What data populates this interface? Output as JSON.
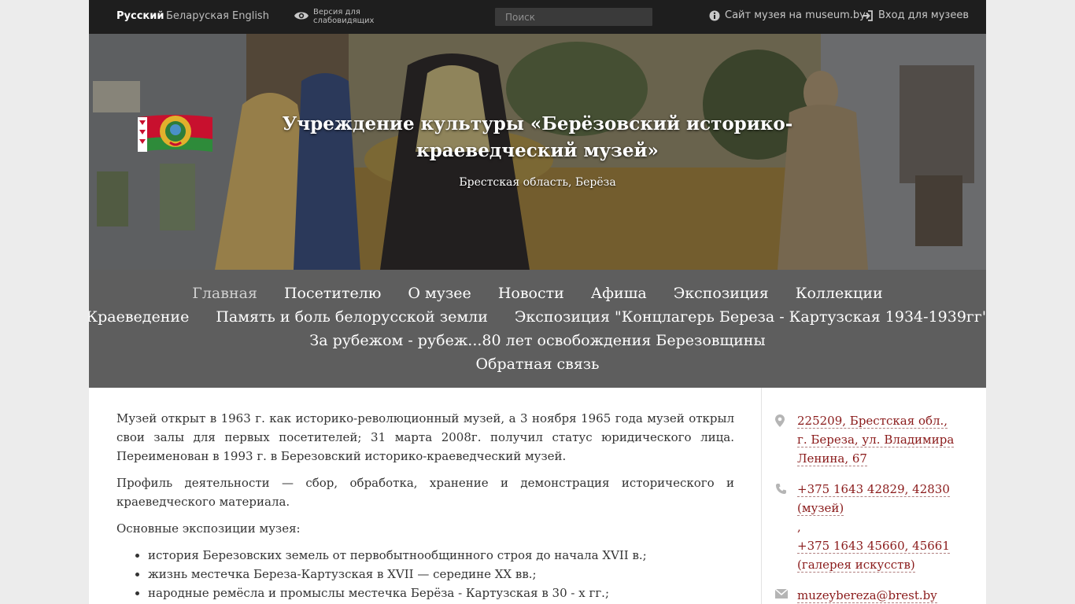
{
  "topbar": {
    "languages": [
      "Русский",
      "Беларуская",
      "English"
    ],
    "vision_label": "Версия для слабовидящих",
    "search_placeholder": "Поиск",
    "museum_site_label": "Сайт музея на museum.by",
    "login_label": "Вход для музеев"
  },
  "hero": {
    "title": "Учреждение культуры «Берёзовский историко-краеведческий музей»",
    "subtitle": "Брестская область, Берёза"
  },
  "nav": {
    "rows": [
      [
        "Главная",
        "Посетителю",
        "О музее",
        "Новости",
        "Афиша",
        "Экспозиция",
        "Коллекции"
      ],
      [
        "Краеведение",
        "Память и боль белорусской земли",
        "Экспозиция \"Концлагерь Береза - Картузская 1934-1939гг\""
      ],
      [
        "За рубежом - рубеж...80 лет освобождения Березовщины"
      ],
      [
        "Обратная связь"
      ]
    ],
    "active": "Главная"
  },
  "content": {
    "p1": "Музей открыт в 1963 г. как историко-революционный музей, а 3 ноября 1965 года музей открыл свои залы для первых посетителей;  31 марта 2008г. получил статус юридического лица. Переименован в 1993 г. в Березовский историко-краеведческий музей.",
    "p2": "Профиль деятельности — сбор, обработка, хранение и демонстрация исторического и краеведческого материала.",
    "p3": "Основные экспозиции музея:",
    "list": [
      "история Березовских земель от первобытнообщинного строя до начала XVII в.;",
      "жизнь местечка Береза-Картузская в XVII — середине XX вв.;",
      "народные ремёсла и промыслы местечка Берёза - Картузская в 30 - х гг.;"
    ]
  },
  "sidebar": {
    "address": "225209, Брестская обл., г. Береза, ул. Владимира Ленина, 67",
    "phone1": "+375 1643 42829, 42830 (музей)",
    "separator": ",",
    "phone2": "+375 1643 45660, 45661 (галерея искусств)",
    "email": "muzeybereza@brest.by"
  },
  "colors": {
    "topbar_bg": "#1e1e1e",
    "nav_bg": "#5e5e5e",
    "link": "#8a1a1a",
    "page_bg": "#ececec"
  }
}
